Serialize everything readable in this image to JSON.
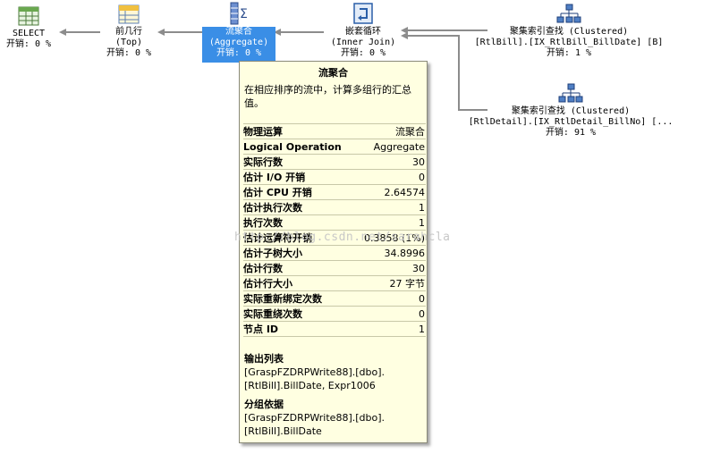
{
  "nodes": {
    "select": {
      "name": "SELECT",
      "cost": "开销: 0 %"
    },
    "top": {
      "name": "前几行",
      "sub": "(Top)",
      "cost": "开销: 0 %"
    },
    "aggregate": {
      "name": "流聚合",
      "sub": "(Aggregate)",
      "cost": "开销: 0 %"
    },
    "loop": {
      "name": "嵌套循环",
      "sub": "(Inner Join)",
      "cost": "开销: 0 %"
    },
    "seek1": {
      "name": "聚集索引查找 (Clustered)",
      "obj": "[RtlBill].[IX_RtlBill_BillDate] [B]",
      "cost": "开销: 1 %"
    },
    "seek2": {
      "name": "聚集索引查找 (Clustered)",
      "obj": "[RtlDetail].[IX_RtlDetail_BillNo] [...",
      "cost": "开销: 91 %"
    }
  },
  "tooltip": {
    "title": "流聚合",
    "description": "在相应排序的流中，计算多组行的汇总值。",
    "properties": [
      {
        "key": "物理运算",
        "value": "流聚合"
      },
      {
        "key": "Logical Operation",
        "value": "Aggregate"
      },
      {
        "key": "实际行数",
        "value": "30"
      },
      {
        "key": "估计 I/O 开销",
        "value": "0"
      },
      {
        "key": "估计 CPU 开销",
        "value": "2.64574"
      },
      {
        "key": "估计执行次数",
        "value": "1"
      },
      {
        "key": "执行次数",
        "value": "1"
      },
      {
        "key": "估计运算符开销",
        "value": "0.3858 (1%)"
      },
      {
        "key": "估计子树大小",
        "value": "34.8996"
      },
      {
        "key": "估计行数",
        "value": "30"
      },
      {
        "key": "估计行大小",
        "value": "27 字节"
      },
      {
        "key": "实际重新绑定次数",
        "value": "0"
      },
      {
        "key": "实际重绕次数",
        "value": "0"
      },
      {
        "key": "节点 ID",
        "value": "1"
      }
    ],
    "output_list": {
      "heading": "输出列表",
      "line1": "[GraspFZDRPWrite88].[dbo].",
      "line2": "[RtlBill].BillDate, Expr1006"
    },
    "group_by": {
      "heading": "分组依据",
      "line1": "[GraspFZDRPWrite88].[dbo].",
      "line2": "[RtlBill].BillDate"
    }
  },
  "watermark": "http://blog.csdn.net/sarahcla"
}
